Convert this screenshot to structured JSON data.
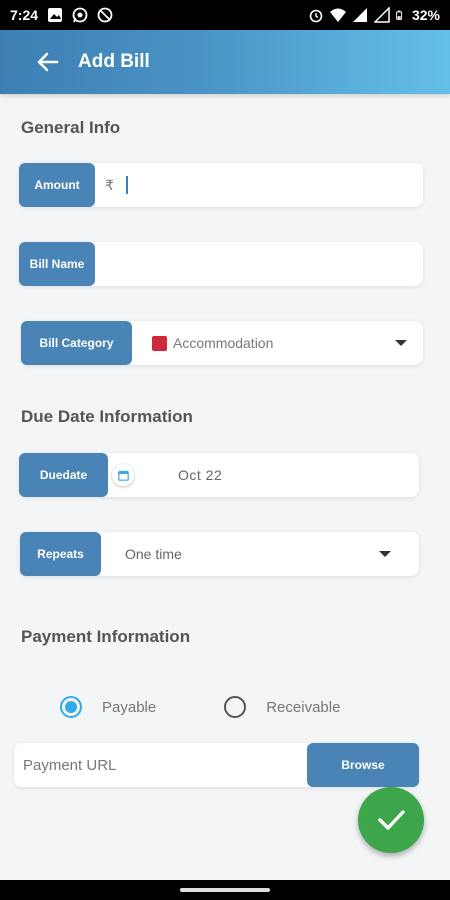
{
  "status_bar": {
    "time": "7:24",
    "battery": "32%",
    "left_icons": [
      "image-icon",
      "whatsapp-icon",
      "dnd-icon"
    ],
    "right_icons": [
      "alarm-icon",
      "wifi-icon",
      "signal-icon",
      "battery-icon"
    ]
  },
  "app_bar": {
    "title": "Add Bill",
    "back_icon": "arrow-left-icon"
  },
  "sections": {
    "general": "General Info",
    "due": "Due Date Information",
    "payment": "Payment Information"
  },
  "fields": {
    "amount": {
      "label": "Amount",
      "currency": "₹",
      "value": ""
    },
    "bill_name": {
      "label": "Bill Name",
      "value": ""
    },
    "bill_category": {
      "label": "Bill Category",
      "value": "Accommodation",
      "swatch_color": "#d0283a"
    },
    "duedate": {
      "label": "Duedate",
      "value": "Oct  22"
    },
    "repeats": {
      "label": "Repeats",
      "value": "One time"
    }
  },
  "payment_type": {
    "options": [
      "Payable",
      "Receivable"
    ],
    "selected": "Payable"
  },
  "payment_url": {
    "placeholder": "Payment URL",
    "value": "",
    "browse_label": "Browse"
  },
  "colors": {
    "accent": "#4a84b6",
    "fab": "#3da54a",
    "radio": "#36a9e8"
  }
}
